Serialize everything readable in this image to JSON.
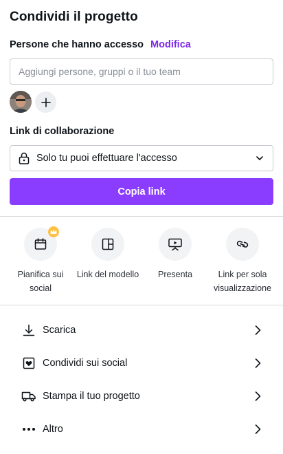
{
  "title": "Condividi il progetto",
  "access": {
    "label": "Persone che hanno accesso",
    "edit_label": "Modifica",
    "invite_placeholder": "Aggiungi persone, gruppi o il tuo team"
  },
  "link_section": {
    "label": "Link di collaborazione",
    "access_option": "Solo tu puoi effettuare l'accesso"
  },
  "copy_button_label": "Copia link",
  "quick_actions": [
    {
      "label": "Pianifica sui social",
      "icon": "calendar-icon",
      "badge": "crown-icon"
    },
    {
      "label": "Link del modello",
      "icon": "template-icon"
    },
    {
      "label": "Presenta",
      "icon": "present-icon"
    },
    {
      "label": "Link per sola visualizzazione",
      "icon": "link-icon"
    }
  ],
  "menu": [
    {
      "label": "Scarica",
      "icon": "download-icon"
    },
    {
      "label": "Condividi sui social",
      "icon": "heart-icon"
    },
    {
      "label": "Stampa il tuo progetto",
      "icon": "truck-icon"
    },
    {
      "label": "Altro",
      "icon": "more-icon"
    }
  ],
  "colors": {
    "accent": "#8b3dff",
    "accent_text": "#7d2ae8",
    "crown": "#ffc043"
  }
}
